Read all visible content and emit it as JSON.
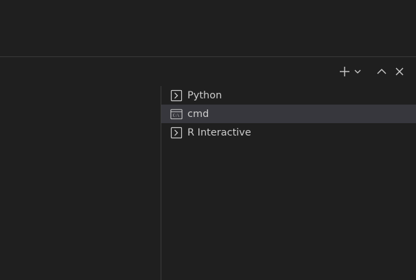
{
  "panel": {
    "toolbar": {
      "new_terminal_icon": "plus-icon",
      "launch_profile_icon": "chevron-down-icon",
      "maximize_icon": "chevron-up-icon",
      "close_icon": "close-icon"
    },
    "terminal_tabs": [
      {
        "label": "Python",
        "icon": "terminal-icon",
        "selected": false
      },
      {
        "label": "cmd",
        "icon": "cmd-terminal-icon",
        "selected": true
      },
      {
        "label": "R Interactive",
        "icon": "terminal-icon",
        "selected": false
      }
    ]
  },
  "colors": {
    "background": "#1f1f1f",
    "selected_tab": "#37373d",
    "divider": "#3c3c3c",
    "foreground": "#cccccc"
  }
}
